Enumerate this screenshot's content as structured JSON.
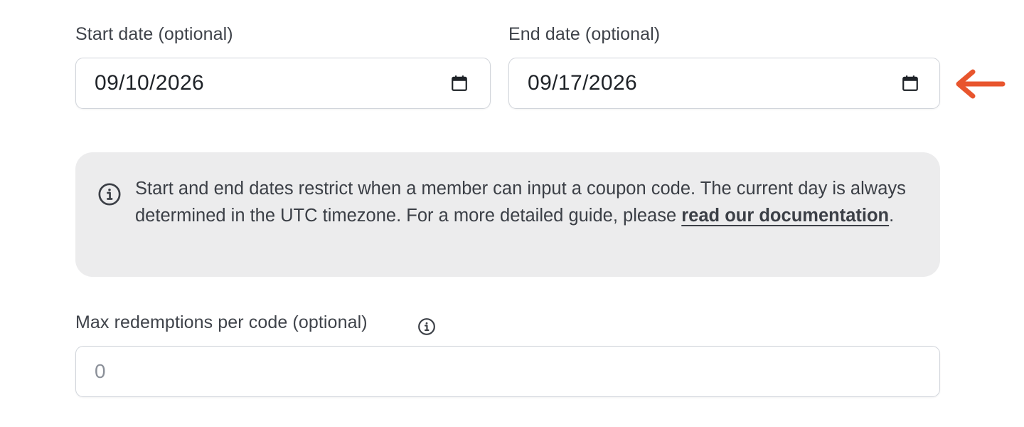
{
  "start_date": {
    "label": "Start date (optional)",
    "value": "09/10/2026",
    "icon": "calendar-icon"
  },
  "end_date": {
    "label": "End date (optional)",
    "value": "09/17/2026",
    "icon": "calendar-icon"
  },
  "info": {
    "icon": "info-icon",
    "text_before": "Start and end dates restrict when a member can input a coupon code. The current day is always determined in the UTC timezone. For a more detailed guide, please ",
    "link_text": "read our documentation",
    "text_after": "."
  },
  "max_redemptions": {
    "label": "Max redemptions per code (optional)",
    "placeholder": "0",
    "icon": "info-icon"
  },
  "annotation": {
    "icon": "arrow-left-icon",
    "color": "#e8552d"
  },
  "colors": {
    "info_background": "#ececed",
    "input_border": "#d1d5db",
    "arrow": "#e8552d"
  }
}
